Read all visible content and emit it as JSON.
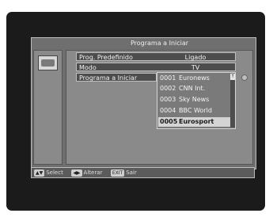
{
  "title": "Programa a Iniciar",
  "rows": [
    {
      "label": "Prog. Predefinido",
      "value": "Ligado"
    },
    {
      "label": "Modo",
      "value": "TV"
    },
    {
      "label": "Programa a Iniciar",
      "value": ""
    }
  ],
  "dropdown": {
    "items": [
      {
        "num": "0001",
        "name": "Euronews"
      },
      {
        "num": "0002",
        "name": "CNN Int."
      },
      {
        "num": "0003",
        "name": "Sky News"
      },
      {
        "num": "0004",
        "name": "BBC World"
      },
      {
        "num": "0005",
        "name": "Eurosport"
      }
    ],
    "selected_index": 4
  },
  "footer": {
    "select": "Select",
    "alterar": "Alterar",
    "sair": "Sair",
    "exit_key": "EXIT",
    "select_key": "▲▼",
    "alterar_key": "◀▶"
  },
  "scroll_arrow": "↑"
}
